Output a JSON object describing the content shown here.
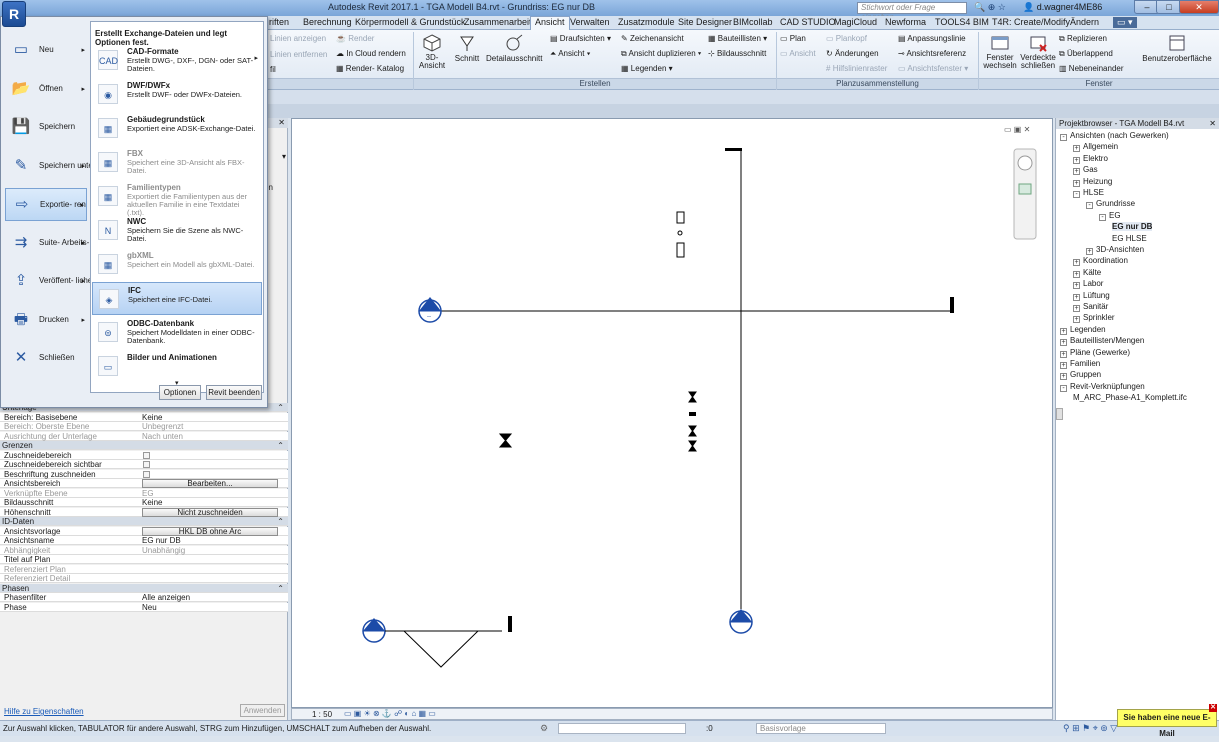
{
  "window": {
    "title": "Autodesk Revit 2017.1 -   TGA Modell B4.rvt - Grundriss: EG nur DB",
    "search_placeholder": "Stichwort oder Frage eingeben",
    "user": "d.wagner4ME86",
    "app_letter": "R"
  },
  "tabs": [
    {
      "label": "Berechnung"
    },
    {
      "label": "Körpermodell & Grundstück"
    },
    {
      "label": "Zusammenarbeit"
    },
    {
      "label": "Ansicht"
    },
    {
      "label": "Verwalten"
    },
    {
      "label": "Zusatzmodule"
    },
    {
      "label": "Site Designer"
    },
    {
      "label": "BIMcollab"
    },
    {
      "label": "CAD STUDIO"
    },
    {
      "label": "MagiCloud"
    },
    {
      "label": "Newforma"
    },
    {
      "label": "TOOLS4 BIM"
    },
    {
      "label": "T4R: Create/Modify"
    },
    {
      "label": "Ändern"
    }
  ],
  "tab_partial": "riften",
  "ribbon": {
    "items_a": [
      "Linien anzeigen",
      "Linien entfernen",
      "fil"
    ],
    "items_b": [
      "Render",
      "In Cloud  rendern",
      "Render- Katalog"
    ],
    "big": [
      "3D-Ansicht",
      "Schnitt",
      "Detailausschnitt"
    ],
    "create": [
      "Draufsichten",
      "Ansicht",
      "Zeichenansicht",
      "Ansicht duplizieren",
      "Legenden",
      "Bauteillisten",
      "Bildausschnitt"
    ],
    "sheet": [
      "Plan",
      "Plankopf",
      "Ansicht",
      "Änderungen",
      "Hilfslinienraster",
      "Anpassungslinie",
      "Ansichtsreferenz",
      "Ansichtsfenster"
    ],
    "window": [
      "Fenster wechseln",
      "Verdeckte schließen",
      "Replizieren",
      "Überlappend",
      "Nebeneinander",
      "Benutzeroberfläche"
    ],
    "groups": [
      "Erstellen",
      "Planzusammenstellung",
      "Fenster"
    ]
  },
  "app_menu": {
    "left_items": [
      "Neu",
      "Öffnen",
      "Speichern",
      "Speichern unter",
      "Exportie- ren",
      "Suite- Arbeits- abläufe",
      "Veröffent- lichen",
      "Drucken",
      "Schließen"
    ],
    "header": "Erstellt Exchange-Dateien und legt Optionen fest.",
    "items": [
      {
        "title": "CAD-Formate",
        "desc": "Erstellt DWG-, DXF-, DGN- oder SAT-Dateien."
      },
      {
        "title": "DWF/DWFx",
        "desc": "Erstellt DWF- oder DWFx-Dateien."
      },
      {
        "title": "Gebäudegrundstück",
        "desc": "Exportiert eine ADSK-Exchange-Datei."
      },
      {
        "title": "FBX",
        "desc": "Speichert eine 3D-Ansicht als FBX-Datei."
      },
      {
        "title": "Familientypen",
        "desc": "Exportiert die Familientypen aus der aktuellen Familie in eine Textdatei (.txt)."
      },
      {
        "title": "NWC",
        "desc": "Speichern Sie die Szene als NWC-Datei."
      },
      {
        "title": "gbXML",
        "desc": "Speichert ein Modell als gbXML-Datei."
      },
      {
        "title": "IFC",
        "desc": "Speichert eine IFC-Datei."
      },
      {
        "title": "ODBC-Datenbank",
        "desc": "Speichert Modelldaten in einer ODBC-Datenbank."
      },
      {
        "title": "Bilder und Animationen",
        "desc": ""
      }
    ],
    "options_label": "Optionen",
    "exit_label": "Revit beenden"
  },
  "props": {
    "cut_header": "Unterlage",
    "rows": [
      {
        "k": "Bereich: Basisebene",
        "v": "Keine",
        "type": "text"
      },
      {
        "k": "Bereich: Oberste Ebene",
        "v": "Unbegrenzt",
        "type": "dim"
      },
      {
        "k": "Ausrichtung der Unterlage",
        "v": "Nach unten",
        "type": "dim"
      },
      {
        "k": "Grenzen",
        "v": "",
        "type": "head"
      },
      {
        "k": "Zuschneidebereich",
        "v": "",
        "type": "cb"
      },
      {
        "k": "Zuschneidebereich sichtbar",
        "v": "",
        "type": "cb"
      },
      {
        "k": "Beschriftung zuschneiden",
        "v": "",
        "type": "cb"
      },
      {
        "k": "Ansichtsbereich",
        "v": "Bearbeiten...",
        "type": "btn"
      },
      {
        "k": "Verknüpfte Ebene",
        "v": "EG",
        "type": "dim"
      },
      {
        "k": "Bildausschnitt",
        "v": "Keine",
        "type": "text"
      },
      {
        "k": "Höhenschnitt",
        "v": "Nicht zuschneiden",
        "type": "btn"
      },
      {
        "k": "ID-Daten",
        "v": "",
        "type": "head"
      },
      {
        "k": "Ansichtsvorlage",
        "v": "HKL DB ohne Arc",
        "type": "btn"
      },
      {
        "k": "Ansichtsname",
        "v": "EG nur DB",
        "type": "text"
      },
      {
        "k": "Abhängigkeit",
        "v": "Unabhängig",
        "type": "dim"
      },
      {
        "k": "Titel auf Plan",
        "v": "",
        "type": "text"
      },
      {
        "k": "Referenziert Plan",
        "v": "",
        "type": "dim"
      },
      {
        "k": "Referenziert Detail",
        "v": "",
        "type": "dim"
      },
      {
        "k": "Phasen",
        "v": "",
        "type": "head"
      },
      {
        "k": "Phasenfilter",
        "v": "Alle anzeigen",
        "type": "text"
      },
      {
        "k": "Phase",
        "v": "Neu",
        "type": "text"
      }
    ],
    "help_link": "Hilfe zu Eigenschaften",
    "apply": "Anwenden",
    "partial_label": "iten"
  },
  "browser": {
    "title": "Projektbrowser - TGA Modell B4.rvt",
    "nodes": [
      {
        "label": "Ansichten (nach Gewerken)",
        "depth": 0,
        "sign": "-"
      },
      {
        "label": "Allgemein",
        "depth": 1,
        "sign": "+"
      },
      {
        "label": "Elektro",
        "depth": 1,
        "sign": "+"
      },
      {
        "label": "Gas",
        "depth": 1,
        "sign": "+"
      },
      {
        "label": "Heizung",
        "depth": 1,
        "sign": "+"
      },
      {
        "label": "HLSE",
        "depth": 1,
        "sign": "-"
      },
      {
        "label": "Grundrisse",
        "depth": 2,
        "sign": "-"
      },
      {
        "label": "EG",
        "depth": 3,
        "sign": "-"
      },
      {
        "label": "EG nur DB",
        "depth": 4,
        "sign": "",
        "bold": true
      },
      {
        "label": "EG HLSE",
        "depth": 4,
        "sign": ""
      },
      {
        "label": "3D-Ansichten",
        "depth": 2,
        "sign": "+"
      },
      {
        "label": "Koordination",
        "depth": 1,
        "sign": "+"
      },
      {
        "label": "Kälte",
        "depth": 1,
        "sign": "+"
      },
      {
        "label": "Labor",
        "depth": 1,
        "sign": "+"
      },
      {
        "label": "Lüftung",
        "depth": 1,
        "sign": "+"
      },
      {
        "label": "Sanitär",
        "depth": 1,
        "sign": "+"
      },
      {
        "label": "Sprinkler",
        "depth": 1,
        "sign": "+"
      },
      {
        "label": "Legenden",
        "depth": 0,
        "sign": "+"
      },
      {
        "label": "Bauteillisten/Mengen",
        "depth": 0,
        "sign": "+"
      },
      {
        "label": "Pläne (Gewerke)",
        "depth": 0,
        "sign": "+"
      },
      {
        "label": "Familien",
        "depth": 0,
        "sign": "+"
      },
      {
        "label": "Gruppen",
        "depth": 0,
        "sign": "+"
      },
      {
        "label": "Revit-Verknüpfungen",
        "depth": 0,
        "sign": "-"
      },
      {
        "label": "M_ARC_Phase-A1_Komplett.ifc",
        "depth": 1,
        "sign": ""
      }
    ]
  },
  "canvas": {
    "scale": "1 : 50"
  },
  "status": {
    "text": "Zur Auswahl klicken, TABULATOR für andere Auswahl, STRG zum Hinzufügen, UMSCHALT zum Aufheben der Auswahl.",
    "zero": ":0",
    "basis": "Basisvorlage",
    "mail": "Sie haben eine neue E-Mail"
  },
  "colors": {
    "accent": "#1c4b93",
    "selection": "#b6d2f3",
    "toast": "#ffff66"
  }
}
